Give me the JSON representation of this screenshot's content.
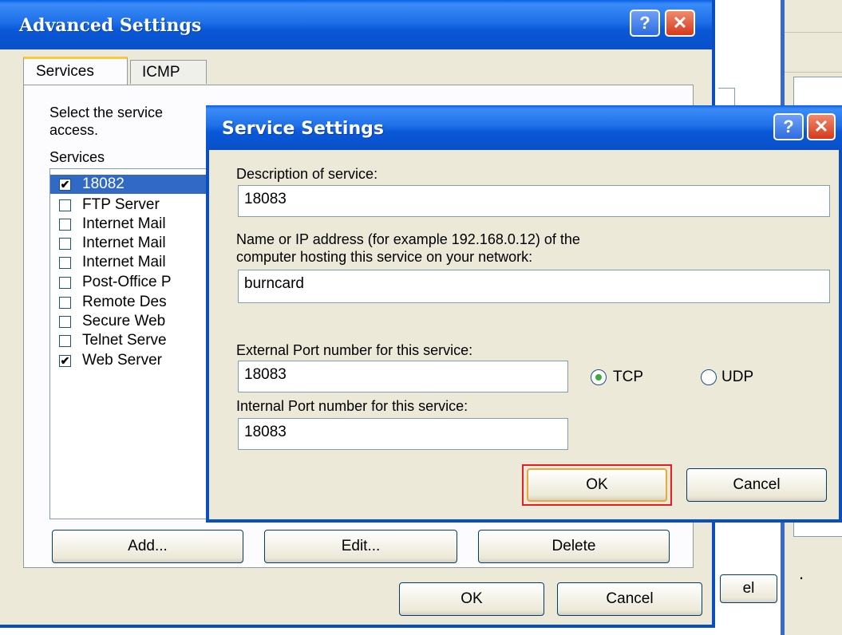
{
  "advanced_window": {
    "title": "Advanced Settings",
    "tabs": [
      {
        "label": "Services",
        "active": true
      },
      {
        "label": "ICMP",
        "active": false
      }
    ],
    "description_line1": "Select the service",
    "description_line2": "access.",
    "services_label": "Services",
    "services": [
      {
        "label": "18082",
        "checked": true,
        "selected": true
      },
      {
        "label": "FTP Server",
        "checked": false
      },
      {
        "label": "Internet Mail",
        "checked": false
      },
      {
        "label": "Internet Mail",
        "checked": false
      },
      {
        "label": "Internet Mail",
        "checked": false
      },
      {
        "label": "Post-Office P",
        "checked": false
      },
      {
        "label": "Remote Des",
        "checked": false
      },
      {
        "label": "Secure Web",
        "checked": false
      },
      {
        "label": "Telnet Serve",
        "checked": false
      },
      {
        "label": "Web Server",
        "checked": true
      }
    ],
    "add_label": "Add...",
    "edit_label": "Edit...",
    "delete_label": "Delete",
    "ok_label": "OK",
    "cancel_label": "Cancel"
  },
  "background_window": {
    "partial_button_label": "el"
  },
  "service_dialog": {
    "title": "Service Settings",
    "description_label": "Description of service:",
    "description_value": "18083",
    "host_label_line1": "Name or IP address (for example 192.168.0.12) of the",
    "host_label_line2": "computer hosting this service on your network:",
    "host_value": "burncard",
    "external_port_label": "External Port number for this service:",
    "external_port_value": "18083",
    "internal_port_label": "Internal Port number for this service:",
    "internal_port_value": "18083",
    "protocol_tcp": "TCP",
    "protocol_udp": "UDP",
    "selected_protocol": "TCP",
    "ok_label": "OK",
    "cancel_label": "Cancel"
  },
  "colors": {
    "xp_title_blue": "#0a58d8",
    "dialog_face": "#ece9d8",
    "list_selection": "#316ac5",
    "ok_highlight": "#e02020"
  }
}
